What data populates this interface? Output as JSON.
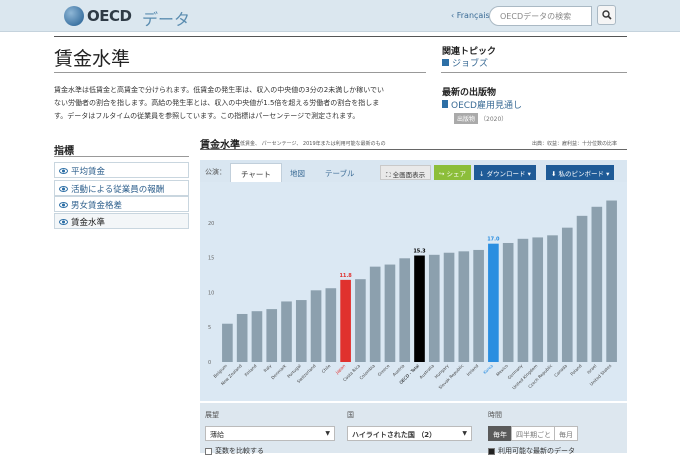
{
  "header": {
    "logo_text": "OECD",
    "section": "データ",
    "lang_link": "‹ Français",
    "search_placeholder": "OECDデータの検索"
  },
  "page": {
    "title": "賃金水準",
    "description": "賃金水準は低賃金と高賃金で分けられます。低賃金の発生率は、収入の中央値の3分の2未満しか稼いでいない労働者の割合を指します。高給の発生率とは、収入の中央値が1.5倍を超える労働者の割合を指します。データはフルタイムの従業員を参照しています。この指標はパーセンテージで測定されます。"
  },
  "related": {
    "heading": "関連トピック",
    "topic": "ジョブズ",
    "pub_heading": "最新の出版物",
    "pub_title": "OECD雇用見通し",
    "pub_badge": "出版物",
    "pub_year": "（2020）"
  },
  "sidebar": {
    "heading": "指標",
    "items": [
      {
        "label": "平均賃金"
      },
      {
        "label": "活動による従業員の報酬"
      },
      {
        "label": "男女賃金格差"
      },
      {
        "label": "賃金水準"
      }
    ]
  },
  "chart_header": {
    "title": "賃金水準",
    "subtitle": "低賃金、 パーセンテージ、 2019年または利用可能な最新のもの",
    "source": "出典：収益：雇利益：十分位数の比率"
  },
  "toolbar": {
    "label": "公演：",
    "tabs": [
      "チャート",
      "地図",
      "テーブル"
    ],
    "fullscreen": "全画面表示",
    "share": "シェア",
    "download": "ダウンロード",
    "pin": "私のピンボード"
  },
  "chart_data": {
    "type": "bar",
    "categories": [
      "Belgium",
      "New Zealand",
      "Finland",
      "Italy",
      "Denmark",
      "Portugal",
      "Switzerland",
      "Chile",
      "Japan",
      "Costa Rica",
      "Colombia",
      "Greece",
      "Austria",
      "OECD - Total",
      "Australia",
      "Hungary",
      "Slovak Republic",
      "Ireland",
      "Korea",
      "Mexico",
      "Germany",
      "United Kingdom",
      "Czech Republic",
      "Canada",
      "Poland",
      "Israel",
      "United States"
    ],
    "values": [
      5.5,
      6.9,
      7.3,
      7.6,
      8.7,
      8.9,
      10.3,
      10.6,
      11.8,
      11.9,
      13.7,
      14.0,
      14.9,
      15.3,
      15.4,
      15.7,
      15.9,
      16.1,
      17.0,
      17.1,
      17.7,
      17.9,
      18.2,
      19.3,
      21.0,
      22.3,
      23.2
    ],
    "highlight": {
      "Japan": "#e0312e",
      "OECD - Total": "#000000",
      "Korea": "#2a8ee0"
    },
    "labeled": {
      "Japan": "11.8",
      "OECD - Total": "15.3",
      "Korea": "17.0"
    },
    "default_color": "#8ca0ae",
    "yticks": [
      0,
      5,
      10,
      15,
      20
    ],
    "ylim": [
      0,
      25
    ]
  },
  "controls": {
    "prospect_label": "展望",
    "prospect_value": "薄給",
    "country_label": "国",
    "country_value": "ハイライトされた国 （2）",
    "time_label": "時間",
    "time_options": [
      "毎年",
      "四半期ごと",
      "毎月"
    ],
    "compare_label": "変数を比較する",
    "latest_label": "利用可能な最新のデータ"
  }
}
